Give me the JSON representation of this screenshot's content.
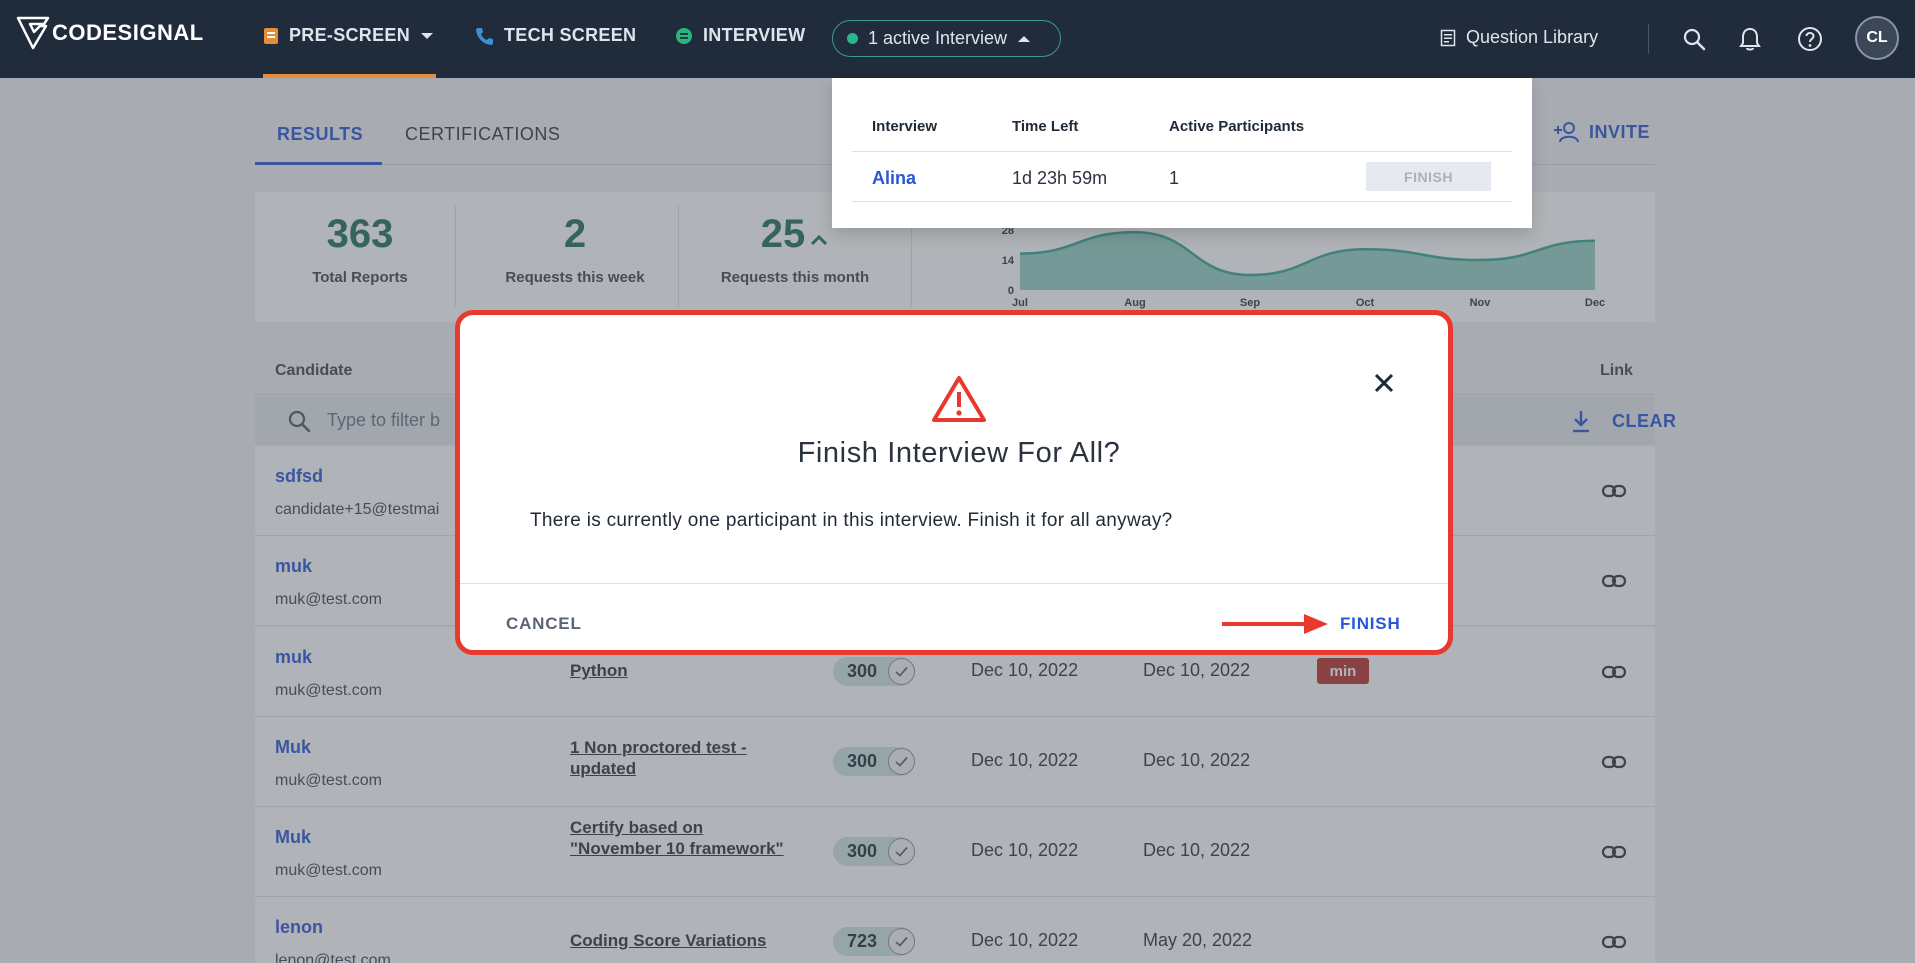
{
  "nav": {
    "logo_text": "CODESIGNAL",
    "prescreen": "PRE-SCREEN",
    "techscreen": "TECH SCREEN",
    "interview": "INTERVIEW",
    "active_interview": "1 active Interview",
    "question_library": "Question Library",
    "avatar_initials": "CL"
  },
  "tabs": {
    "results": "RESULTS",
    "certifications": "CERTIFICATIONS",
    "invite": "INVITE"
  },
  "stats": [
    {
      "value": "363",
      "label": "Total Reports"
    },
    {
      "value": "2",
      "label": "Requests this week"
    },
    {
      "value": "25",
      "label": "Requests this month"
    }
  ],
  "chart_data": {
    "type": "area",
    "categories": [
      "Jul",
      "Aug",
      "Sep",
      "Oct",
      "Nov",
      "Dec"
    ],
    "values": [
      17,
      27,
      7,
      19,
      14,
      23
    ],
    "yticks": [
      0,
      14,
      28
    ],
    "ylim": [
      0,
      28
    ],
    "color": "#3aa792"
  },
  "table": {
    "col_candidate": "Candidate",
    "col_link": "Link",
    "filter_placeholder": "Type to filter b",
    "clear": "CLEAR",
    "rows": [
      {
        "name": "sdfsd",
        "email": "candidate+15@testmai",
        "test": "",
        "score": "",
        "started": "",
        "completed": "",
        "badge": ""
      },
      {
        "name": "muk",
        "email": "muk@test.com",
        "test": "",
        "score": "",
        "started": "",
        "completed": "",
        "badge": ""
      },
      {
        "name": "muk",
        "email": "muk@test.com",
        "test": "Python",
        "score": "300",
        "started": "Dec 10, 2022",
        "completed": "Dec 10, 2022",
        "badge": "min"
      },
      {
        "name": "Muk",
        "email": "muk@test.com",
        "test": "1 Non proctored test - updated",
        "score": "300",
        "started": "Dec 10, 2022",
        "completed": "Dec 10, 2022",
        "badge": ""
      },
      {
        "name": "Muk",
        "email": "muk@test.com",
        "test": "Certify based on \"November 10 framework\"",
        "score": "300",
        "started": "Dec 10, 2022",
        "completed": "Dec 10, 2022",
        "badge": ""
      },
      {
        "name": "lenon",
        "email": "lenon@test.com",
        "test": "Coding Score Variations",
        "score": "723",
        "started": "Dec 10, 2022",
        "completed": "May 20, 2022",
        "badge": ""
      }
    ]
  },
  "dropdown": {
    "col_interview": "Interview",
    "col_time_left": "Time Left",
    "col_active": "Active Participants",
    "row": {
      "name": "Alina",
      "time_left": "1d 23h 59m",
      "participants": "1",
      "finish": "FINISH"
    }
  },
  "modal": {
    "title": "Finish Interview For All?",
    "body": "There is currently one participant in this interview. Finish it for all anyway?",
    "cancel": "CANCEL",
    "finish": "FINISH",
    "accent": "#e9382d"
  }
}
